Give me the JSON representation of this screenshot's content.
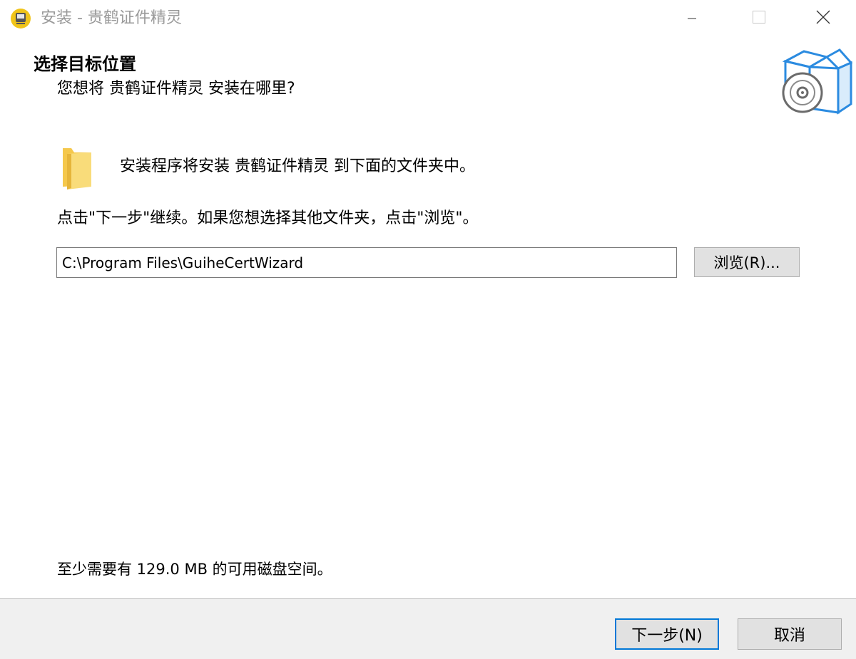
{
  "window": {
    "title": "安装 - 贵鹤证件精灵",
    "icons": {
      "app": "installer-app-icon",
      "minimize": "minimize-icon",
      "maximize": "maximize-icon",
      "close": "close-icon"
    }
  },
  "header": {
    "title": "选择目标位置",
    "subtitle": "您想将 贵鹤证件精灵 安装在哪里?",
    "icon": "setup-box-disc-icon"
  },
  "main": {
    "folder_icon": "folder-icon",
    "intro": "安装程序将安装 贵鹤证件精灵 到下面的文件夹中。",
    "instruction": "点击\"下一步\"继续。如果您想选择其他文件夹，点击\"浏览\"。",
    "path_value": "C:\\Program Files\\GuiheCertWizard",
    "browse_label": "浏览(R)...",
    "disk_space": "至少需要有 129.0 MB 的可用磁盘空间。"
  },
  "footer": {
    "next_label": "下一步(N)",
    "cancel_label": "取消"
  },
  "colors": {
    "accent": "#0078d7",
    "button_face": "#e1e1e1",
    "footer_bg": "#f0f0f0",
    "folder": "#f5c84c",
    "app_icon": "#f0c419"
  }
}
